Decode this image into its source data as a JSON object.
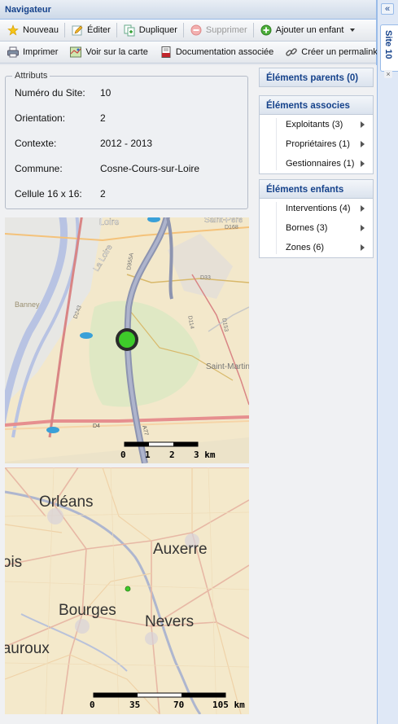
{
  "window": {
    "title": "Navigateur"
  },
  "toolbar1": [
    {
      "id": "nouveau",
      "label": "Nouveau",
      "icon": "star-icon",
      "disabled": false
    },
    {
      "id": "editer",
      "label": "Éditer",
      "icon": "pencil-icon",
      "disabled": false
    },
    {
      "id": "dupliquer",
      "label": "Dupliquer",
      "icon": "duplicate-icon",
      "disabled": false
    },
    {
      "id": "supprimer",
      "label": "Supprimer",
      "icon": "delete-icon",
      "disabled": true
    },
    {
      "id": "ajouter",
      "label": "Ajouter un enfant",
      "icon": "add-icon",
      "disabled": false
    }
  ],
  "toolbar2": [
    {
      "id": "imprimer",
      "label": "Imprimer",
      "icon": "printer-icon"
    },
    {
      "id": "voir-carte",
      "label": "Voir sur la carte",
      "icon": "map-icon"
    },
    {
      "id": "documentation",
      "label": "Documentation associée",
      "icon": "pdf-icon"
    },
    {
      "id": "permalink",
      "label": "Créer un permalink",
      "icon": "link-icon"
    }
  ],
  "attributes": {
    "legend": "Attributs",
    "rows": [
      {
        "label": "Numéro du Site:",
        "value": "10"
      },
      {
        "label": "Orientation:",
        "value": "2"
      },
      {
        "label": "Contexte:",
        "value": "2012 - 2013"
      },
      {
        "label": "Commune:",
        "value": "Cosne-Cours-sur-Loire"
      },
      {
        "label": "Cellule 16 x 16:",
        "value": "2"
      }
    ]
  },
  "map1": {
    "places": [
      "Loire",
      "Saint-Père",
      "La Loire",
      "Banney",
      "Saint-Martin-sur-Nohain"
    ],
    "roads": [
      "D168",
      "D33",
      "D243",
      "D114",
      "D153",
      "D955A",
      "D4",
      "A77"
    ],
    "scale_labels": [
      "0",
      "1",
      "2",
      "3 km"
    ],
    "marker_color": "#3ecb2a"
  },
  "map2": {
    "cities": [
      "Orléans",
      "Auxerre",
      "Blois",
      "Bourges",
      "Nevers",
      "Châteauroux"
    ],
    "scale_labels": [
      "0",
      "35",
      "70",
      "105 km"
    ]
  },
  "right_panel": {
    "parents": {
      "title": "Éléments parents (0)"
    },
    "associes": {
      "title": "Éléments associes",
      "items": [
        "Exploitants (3)",
        "Propriétaires (1)",
        "Gestionnaires (1)"
      ]
    },
    "enfants": {
      "title": "Éléments enfants",
      "items": [
        "Interventions (4)",
        "Bornes (3)",
        "Zones (6)"
      ]
    }
  },
  "side": {
    "tab_label": "Site 10",
    "collapse_glyph": "«",
    "close_glyph": "×"
  }
}
